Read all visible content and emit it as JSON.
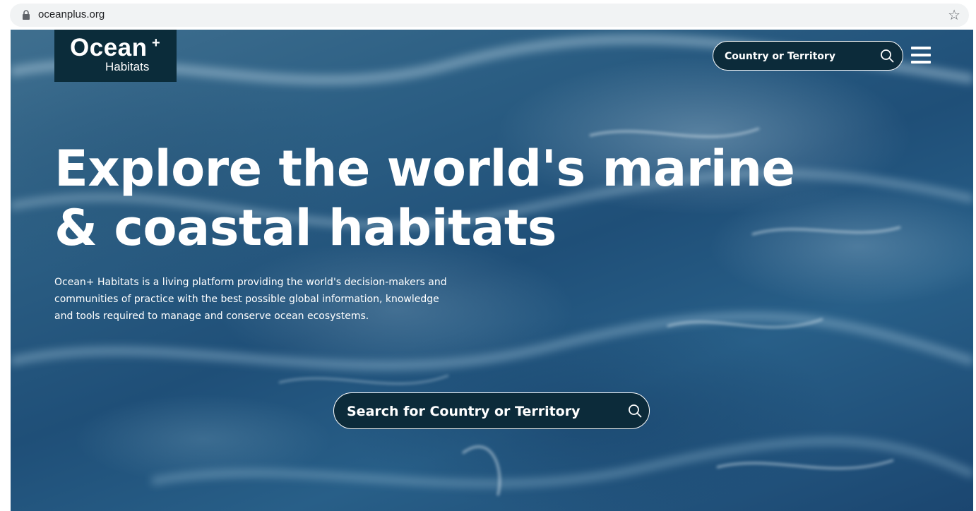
{
  "browser": {
    "url": "oceanplus.org",
    "icons": {
      "lock": "lock-icon",
      "bookmark": "star-icon"
    }
  },
  "header": {
    "logo": {
      "name": "Ocean",
      "plus": "+",
      "subtitle": "Habitats"
    },
    "search": {
      "placeholder": "Country or Territory",
      "icon": "search-icon"
    },
    "menu_icon": "hamburger-menu-icon"
  },
  "hero": {
    "headline_line1": "Explore the world's marine",
    "headline_line2": "& coastal habitats",
    "intro_line1": "Ocean+ Habitats is a living platform providing the world's decision-makers and",
    "intro_line2": "communities of practice with the best possible global information, knowledge",
    "intro_line3": "and tools required to manage and conserve ocean ecosystems.",
    "search": {
      "placeholder": "Search for Country or Territory",
      "icon": "search-icon"
    }
  },
  "colors": {
    "logo_bg": "#0b2c3a",
    "search_bg": "#0c2b3a",
    "text": "#ffffff",
    "browser_bar": "#f1f3f4"
  }
}
